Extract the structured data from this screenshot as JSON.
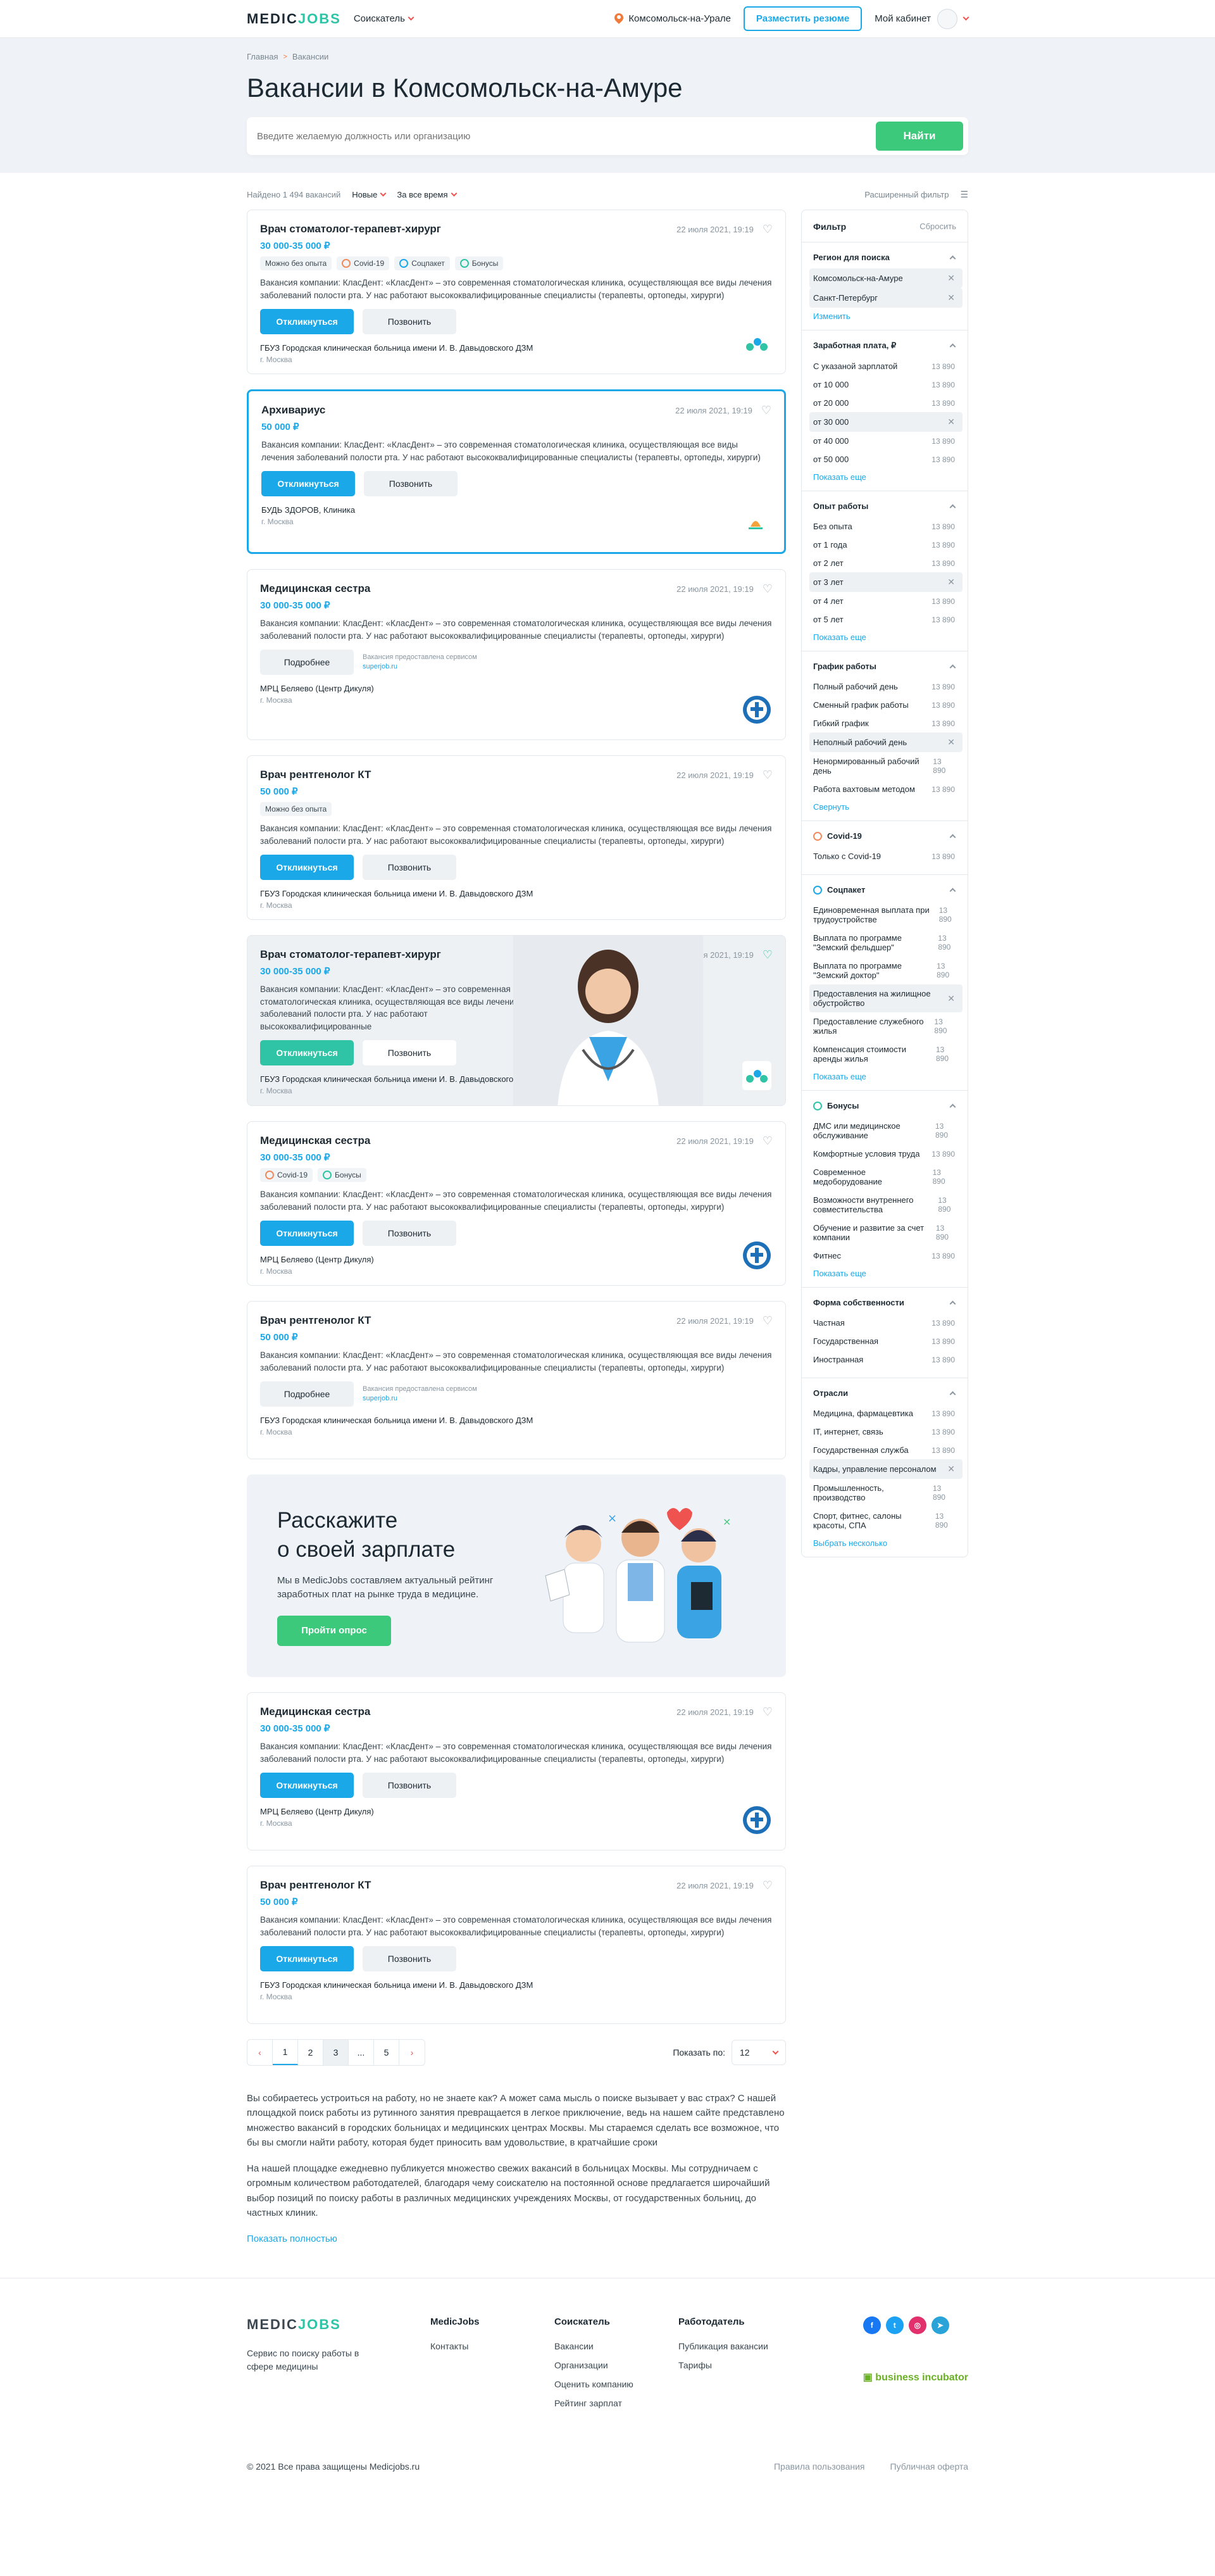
{
  "header": {
    "logo_a": "MEDIC",
    "logo_b": "JOBS",
    "role": "Соискатель",
    "location": "Комсомольск-на-Урале",
    "resume_button": "Разместить резюме",
    "cabinet": "Мой кабинет"
  },
  "hero": {
    "breadcrumb_home": "Главная",
    "breadcrumb_current": "Вакансии",
    "title": "Вакансии в Комсомольск-на-Амуре",
    "search_placeholder": "Введите желаемую должность или организацию",
    "search_button": "Найти"
  },
  "sortbar": {
    "found": "Найдено 1 494 вакансий",
    "sort": "Новые",
    "period": "За все время",
    "advanced": "Расширенный фильтр"
  },
  "labels": {
    "apply": "Откликнуться",
    "call": "Позвонить",
    "more": "Подробнее",
    "source_line1": "Вакансия предоставлена сервисом",
    "source_line2": "superjob.ru"
  },
  "vacancies": [
    {
      "title": "Врач стоматолог-терапевт-хирург",
      "salary": "30 000-35 000 ₽",
      "date": "22 июля 2021, 19:19",
      "tags": [
        "Можно без опыта",
        "Covid-19",
        "Соцпакет",
        "Бонусы"
      ],
      "desc": "Вакансия компании: КласДент: «КласДент» – это современная стоматологическая клиника, осуществляющая все виды лечения заболеваний полости рта. У нас работают высококвалифицированные специалисты (терапевты, ортопеды, хирурги)",
      "org": "ГБУЗ Городская клиническая больница имени И. В. Давыдовского ДЗМ",
      "city": "г. Москва"
    },
    {
      "title": "Архивариус",
      "salary": "50 000 ₽",
      "date": "22 июля 2021, 19:19",
      "desc": "Вакансия компании: КласДент: «КласДент» – это современная стоматологическая клиника, осуществляющая все виды лечения заболеваний полости рта. У нас работают высококвалифицированные специалисты (терапевты, ортопеды, хирурги)",
      "org": "БУДЬ ЗДОРОВ, Клиника",
      "city": "г. Москва"
    },
    {
      "title": "Медицинская сестра",
      "salary": "30 000-35 000 ₽",
      "date": "22 июля 2021, 19:19",
      "desc": "Вакансия компании: КласДент: «КласДент» – это современная стоматологическая клиника, осуществляющая все виды лечения заболеваний полости рта. У нас работают высококвалифицированные специалисты (терапевты, ортопеды, хирурги)",
      "org": "МРЦ Беляево (Центр Дикуля)",
      "city": "г. Москва"
    },
    {
      "title": "Врач рентгенолог КТ",
      "salary": "50 000 ₽",
      "date": "22 июля 2021, 19:19",
      "tags": [
        "Можно без опыта"
      ],
      "desc": "Вакансия компании: КласДент: «КласДент» – это современная стоматологическая клиника, осуществляющая все виды лечения заболеваний полости рта. У нас работают высококвалифицированные специалисты (терапевты, ортопеды, хирурги)",
      "org": "ГБУЗ Городская клиническая больница имени И. В. Давыдовского ДЗМ",
      "city": "г. Москва"
    },
    {
      "title": "Врач стоматолог-терапевт-хирург",
      "salary": "30 000-35 000 ₽",
      "date": "22 июля 2021, 19:19",
      "desc": "Вакансия компании: КласДент: «КласДент» – это современная стоматологическая клиника, осуществляющая все виды лечения заболеваний полости рта. У нас работают высококвалифицированные",
      "org": "ГБУЗ Городская клиническая больница имени И. В. Давыдовского ДЗМ",
      "city": "г. Москва"
    },
    {
      "title": "Медицинская сестра",
      "salary": "30 000-35 000 ₽",
      "date": "22 июля 2021, 19:19",
      "tags": [
        "Covid-19",
        "Бонусы"
      ],
      "desc": "Вакансия компании: КласДент: «КласДент» – это современная стоматологическая клиника, осуществляющая все виды лечения заболеваний полости рта. У нас работают высококвалифицированные специалисты (терапевты, ортопеды, хирурги)",
      "org": "МРЦ Беляево (Центр Дикуля)",
      "city": "г. Москва"
    },
    {
      "title": "Врач рентгенолог КТ",
      "salary": "50 000 ₽",
      "date": "22 июля 2021, 19:19",
      "desc": "Вакансия компании: КласДент: «КласДент» – это современная стоматологическая клиника, осуществляющая все виды лечения заболеваний полости рта. У нас работают высококвалифицированные специалисты (терапевты, ортопеды, хирурги)",
      "org": "ГБУЗ Городская клиническая больница имени И. В. Давыдовского ДЗМ",
      "city": "г. Москва"
    },
    {
      "title": "Медицинская сестра",
      "salary": "30 000-35 000 ₽",
      "date": "22 июля 2021, 19:19",
      "desc": "Вакансия компании: КласДент: «КласДент» – это современная стоматологическая клиника, осуществляющая все виды лечения заболеваний полости рта. У нас работают высококвалифицированные специалисты (терапевты, ортопеды, хирурги)",
      "org": "МРЦ Беляево (Центр Дикуля)",
      "city": "г. Москва"
    },
    {
      "title": "Врач рентгенолог КТ",
      "salary": "50 000 ₽",
      "date": "22 июля 2021, 19:19",
      "desc": "Вакансия компании: КласДент: «КласДент» – это современная стоматологическая клиника, осуществляющая все виды лечения заболеваний полости рта. У нас работают высококвалифицированные специалисты (терапевты, ортопеды, хирурги)",
      "org": "ГБУЗ Городская клиническая больница имени И. В. Давыдовского ДЗМ",
      "city": "г. Москва"
    }
  ],
  "survey": {
    "title_1": "Расскажите",
    "title_2": "о своей зарплате",
    "text": "Мы в MedicJobs составляем актуальный рейтинг заработных плат на рынке труда в медицине.",
    "button": "Пройти опрос"
  },
  "pager": {
    "pages": [
      "1",
      "2",
      "3",
      "...",
      "5"
    ],
    "show_label": "Показать по:",
    "show_value": "12"
  },
  "seo": {
    "p1": "Вы собираетесь устроиться на работу, но не знаете как? А может сама мысль о поиске вызывает у вас страх? С нашей площадкой поиск работы из рутинного занятия превращается в легкое приключение, ведь на нашем сайте представлено множество вакансий в городских больницах и медицинских центрах Москвы. Мы стараемся сделать все возможное, что бы вы смогли найти работу, которая будет приносить вам удовольствие, в кратчайшие сроки",
    "p2": "На нашей площадке ежедневно публикуется множество свежих вакансий в больницах Москвы. Мы сотрудничаем с огромным количеством работодателей, благодаря чему соискателю на постоянной основе предлагается широчайший выбор позиций по поиску работы в различных медицинских учреждениях Москвы, от государственных больниц, до частных клиник.",
    "more": "Показать полностью"
  },
  "filter": {
    "title": "Фильтр",
    "reset": "Сбросить",
    "sections": [
      {
        "title": "Регион для поиска",
        "items": [
          {
            "label": "Комсомольск-на-Амуре",
            "on": true
          },
          {
            "label": "Санкт-Петербург",
            "on": true
          }
        ],
        "more": "Изменить"
      },
      {
        "title": "Заработная плата, ₽",
        "items": [
          {
            "label": "С указаной зарплатой",
            "count": "13 890"
          },
          {
            "label": "от 10 000",
            "count": "13 890"
          },
          {
            "label": "от 20 000",
            "count": "13 890"
          },
          {
            "label": "от 30 000",
            "on": true
          },
          {
            "label": "от 40 000",
            "count": "13 890"
          },
          {
            "label": "от 50 000",
            "count": "13 890"
          }
        ],
        "more": "Показать еще"
      },
      {
        "title": "Опыт работы",
        "items": [
          {
            "label": "Без опыта",
            "count": "13 890"
          },
          {
            "label": "от 1 года",
            "count": "13 890"
          },
          {
            "label": "от 2 лет",
            "count": "13 890"
          },
          {
            "label": "от 3 лет",
            "on": true
          },
          {
            "label": "от 4 лет",
            "count": "13 890"
          },
          {
            "label": "от 5 лет",
            "count": "13 890"
          }
        ],
        "more": "Показать еще"
      },
      {
        "title": "График работы",
        "items": [
          {
            "label": "Полный рабочий день",
            "count": "13 890"
          },
          {
            "label": "Сменный график работы",
            "count": "13 890"
          },
          {
            "label": "Гибкий график",
            "count": "13 890"
          },
          {
            "label": "Неполный рабочий день",
            "on": true
          },
          {
            "label": "Ненормированный рабочий день",
            "count": "13 890"
          },
          {
            "label": "Работа вахтовым методом",
            "count": "13 890"
          }
        ],
        "more": "Свернуть"
      },
      {
        "title": "Covid-19",
        "icon": "covid",
        "items": [
          {
            "label": "Только с Covid-19",
            "count": "13 890"
          }
        ]
      },
      {
        "title": "Соцпакет",
        "icon": "social",
        "items": [
          {
            "label": "Единовременная выплата при трудоустройстве",
            "count": "13 890"
          },
          {
            "label": "Выплата по программе \"Земский фельдшер\"",
            "count": "13 890"
          },
          {
            "label": "Выплата по программе \"Земский доктор\"",
            "count": "13 890"
          },
          {
            "label": "Предоставления на жилищное обустройство",
            "on": true
          },
          {
            "label": "Предоставление служебного жилья",
            "count": "13 890"
          },
          {
            "label": "Компенсация стоимости аренды жилья",
            "count": "13 890"
          }
        ],
        "more": "Показать еще"
      },
      {
        "title": "Бонусы",
        "icon": "bonus",
        "items": [
          {
            "label": "ДМС или медицинское обслуживание",
            "count": "13 890"
          },
          {
            "label": "Комфортные условия труда",
            "count": "13 890"
          },
          {
            "label": "Современное медоборудование",
            "count": "13 890"
          },
          {
            "label": "Возможности внутреннего совместительства",
            "count": "13 890"
          },
          {
            "label": "Обучение и развитие за счет компании",
            "count": "13 890"
          },
          {
            "label": "Фитнес",
            "count": "13 890"
          }
        ],
        "more": "Показать еще"
      },
      {
        "title": "Форма собственности",
        "items": [
          {
            "label": "Частная",
            "count": "13 890"
          },
          {
            "label": "Государственная",
            "count": "13 890"
          },
          {
            "label": "Иностранная",
            "count": "13 890"
          }
        ]
      },
      {
        "title": "Отрасли",
        "items": [
          {
            "label": "Медицина, фармацевтика",
            "count": "13 890"
          },
          {
            "label": "IT, интернет, связь",
            "count": "13 890"
          },
          {
            "label": "Государственная служба",
            "count": "13 890"
          },
          {
            "label": "Кадры, управление персоналом",
            "on": true
          },
          {
            "label": "Промышленность, производство",
            "count": "13 890"
          },
          {
            "label": "Спорт, фитнес, салоны красоты, СПА",
            "count": "13 890"
          }
        ],
        "more": "Выбрать несколько"
      }
    ]
  },
  "footer": {
    "tagline": "Сервис по поиску работы в сфере медицины",
    "col1_title": "MedicJobs",
    "col1": [
      "Контакты"
    ],
    "col2_title": "Соискатель",
    "col2": [
      "Вакансии",
      "Организации",
      "Оценить компанию",
      "Рейтинг зарплат"
    ],
    "col3_title": "Работодатель",
    "col3": [
      "Публикация вакансии",
      "Тарифы"
    ],
    "incubator": "business incubator",
    "copyright": "© 2021 Все права защищены Medicjobs.ru",
    "terms": "Правила пользования",
    "offer": "Публичная оферта"
  }
}
